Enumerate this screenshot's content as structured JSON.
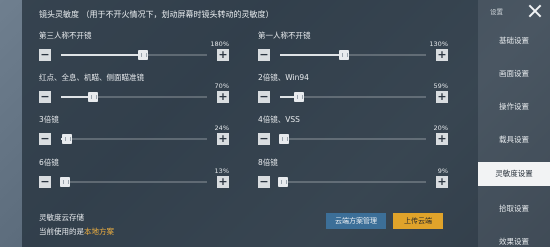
{
  "heading": "镜头灵敏度 （用于不开火情况下，划动屏幕时镜头转动的灵敏度）",
  "sliders": [
    {
      "label": "第三人称不开镜",
      "percent": "180%",
      "value": 0.56
    },
    {
      "label": "第一人称不开镜",
      "percent": "130%",
      "value": 0.44
    },
    {
      "label": "红点、全息、机瞄、侧面瞄准镜",
      "percent": "70%",
      "value": 0.22
    },
    {
      "label": "2倍镜、Win94",
      "percent": "59%",
      "value": 0.13
    },
    {
      "label": "3倍镜",
      "percent": "24%",
      "value": 0.04
    },
    {
      "label": "4倍镜、VSS",
      "percent": "20%",
      "value": 0.03
    },
    {
      "label": "6倍镜",
      "percent": "13%",
      "value": 0.03
    },
    {
      "label": "8倍镜",
      "percent": "9%",
      "value": 0.02
    }
  ],
  "controls": {
    "minus": "−",
    "plus": "+"
  },
  "cloud": {
    "title": "灵敏度云存储",
    "current_prefix": "当前使用的是",
    "current_value": "本地方案",
    "manage_label": "云端方案管理",
    "upload_label": "上传云端"
  },
  "sidebar": {
    "settings_label": "设置",
    "tabs": [
      "基础设置",
      "画面设置",
      "操作设置",
      "载具设置",
      "灵敏度设置",
      "拾取设置",
      "效果设置"
    ],
    "active_index": 4
  }
}
